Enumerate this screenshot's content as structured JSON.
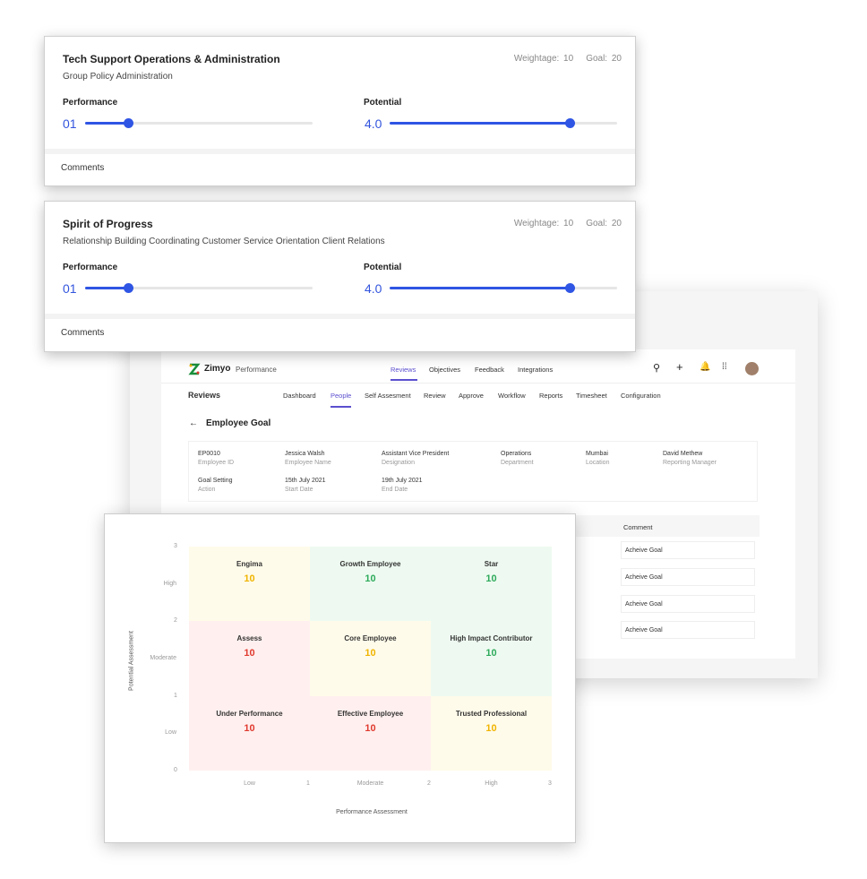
{
  "cards": [
    {
      "title": "Tech Support Operations & Administration",
      "subtitle": "Group Policy Administration",
      "weightage": "Weightage: 10",
      "goal": "Goal: 20",
      "performance_label": "Performance",
      "performance_value": "01",
      "performance_fraction": 0.19,
      "potential_label": "Potential",
      "potential_value": "4.0",
      "potential_fraction": 0.79,
      "comments_label": "Comments"
    },
    {
      "title": "Spirit of Progress",
      "subtitle": "Relationship Building Coordinating Customer Service Orientation Client Relations",
      "weightage": "Weightage: 10",
      "goal": "Goal: 20",
      "performance_label": "Performance",
      "performance_value": "01",
      "performance_fraction": 0.19,
      "potential_label": "Potential",
      "potential_value": "4.0",
      "potential_fraction": 0.79,
      "comments_label": "Comments"
    }
  ],
  "app": {
    "brand": "Zimyo",
    "product": "Performance",
    "nav": [
      "Reviews",
      "Objectives",
      "Feedback",
      "Integrations"
    ],
    "section": "Reviews",
    "subnav": [
      "Dashboard",
      "People",
      "Self Assesment",
      "Review",
      "Approve",
      "Workflow",
      "Reports",
      "Timesheet",
      "Configuration"
    ],
    "page_title": "Employee Goal",
    "info": [
      {
        "value": "EP0010",
        "key": "Employee ID"
      },
      {
        "value": "Jessica Walsh",
        "key": "Employee Name"
      },
      {
        "value": "Assistant Vice President",
        "key": "Designation"
      },
      {
        "value": "Operations",
        "key": "Department"
      },
      {
        "value": "Mumbai",
        "key": "Location"
      },
      {
        "value": "David Methew",
        "key": "Reporting Manager"
      },
      {
        "value": "Goal Setting",
        "key": "Action"
      },
      {
        "value": "15th July 2021",
        "key": "Start Date"
      },
      {
        "value": "19th July 2021",
        "key": "End Date"
      }
    ],
    "comment_header": "Comment",
    "comments": [
      "Acheive Goal",
      "Acheive Goal",
      "Acheive Goal",
      "Acheive Goal"
    ],
    "accent": "#5b4fcf"
  },
  "chart_data": {
    "type": "heatmap",
    "xlabel": "Performance Assessment",
    "ylabel": "Potential Assessment",
    "x_categories": [
      "Low",
      "Moderate",
      "High"
    ],
    "y_categories": [
      "Low",
      "Moderate",
      "High"
    ],
    "x_ticks": [
      "1",
      "2",
      "3"
    ],
    "y_ticks": [
      "0",
      "1",
      "2",
      "3"
    ],
    "xlim": [
      0,
      3
    ],
    "ylim": [
      0,
      3
    ],
    "cells": [
      {
        "name": "Engima",
        "value": 10,
        "x": "Low",
        "y": "High",
        "color": "#f0b400"
      },
      {
        "name": "Growth Employee",
        "value": 10,
        "x": "Moderate",
        "y": "High",
        "color": "#2eaa5c"
      },
      {
        "name": "Star",
        "value": 10,
        "x": "High",
        "y": "High",
        "color": "#2eaa5c"
      },
      {
        "name": "Assess",
        "value": 10,
        "x": "Low",
        "y": "Moderate",
        "color": "#e03a2f"
      },
      {
        "name": "Core Employee",
        "value": 10,
        "x": "Moderate",
        "y": "Moderate",
        "color": "#f0b400"
      },
      {
        "name": "High Impact Contributor",
        "value": 10,
        "x": "High",
        "y": "Moderate",
        "color": "#2eaa5c"
      },
      {
        "name": "Under Performance",
        "value": 10,
        "x": "Low",
        "y": "Low",
        "color": "#e03a2f"
      },
      {
        "name": "Effective Employee",
        "value": 10,
        "x": "Moderate",
        "y": "Low",
        "color": "#e03a2f"
      },
      {
        "name": "Trusted Professional",
        "value": 10,
        "x": "High",
        "y": "Low",
        "color": "#f0b400"
      }
    ]
  }
}
